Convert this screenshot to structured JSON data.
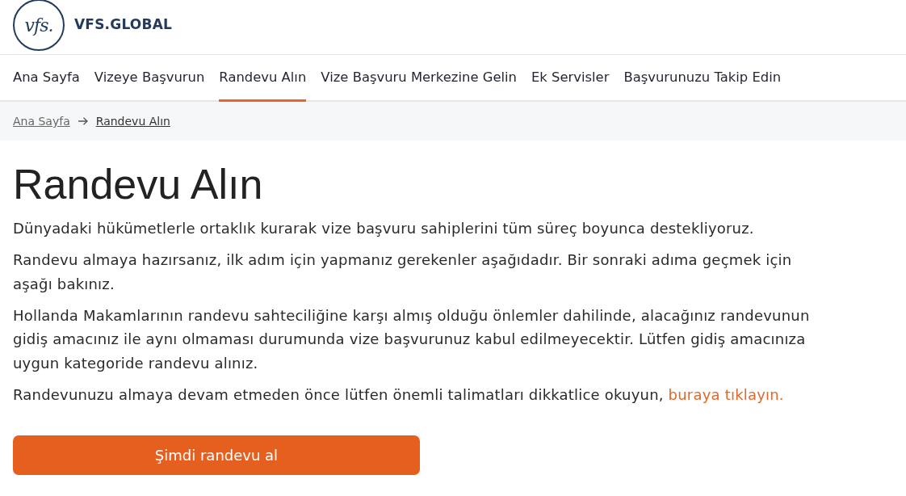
{
  "header": {
    "logo_mark": "vfs.",
    "brand_name": "VFS.GLOBAL"
  },
  "nav": [
    {
      "label": "Ana Sayfa",
      "selected": false
    },
    {
      "label": "Vizeye Başvurun",
      "selected": false
    },
    {
      "label": "Randevu Alın",
      "selected": true
    },
    {
      "label": "Vize Başvuru Merkezine Gelin",
      "selected": false
    },
    {
      "label": "Ek Servisler",
      "selected": false
    },
    {
      "label": "Başvurunuzu Takip Edin",
      "selected": false
    }
  ],
  "breadcrumb": [
    "Ana Sayfa",
    "Randevu Alın"
  ],
  "page": {
    "title": "Randevu Alın",
    "paragraphs": [
      {
        "text": "Dünyadaki hükümetlerle ortaklık kurarak vize başvuru sahiplerini tüm süreç boyunca destekliyoruz."
      },
      {
        "text": "Randevu almaya hazırsanız, ilk adım için yapmanız gerekenler aşağıdadır. Bir sonraki adıma geçmek için aşağı bakınız."
      },
      {
        "text": "Hollanda Makamlarının randevu sahteciliğine karşı almış olduğu önlemler dahilinde, alacağınız randevunun gidiş amacınız ile aynı olmaması durumunda vize başvurunuz kabul edilmeyecektir. Lütfen gidiş amacınıza uygun kategoride randevu alınız."
      },
      {
        "text": "Randevunuzu almaya devam etmeden önce lütfen önemli talimatları dikkatlice okuyun,",
        "link": "buraya tıklayın."
      }
    ],
    "button": "Şimdi randevu al"
  }
}
